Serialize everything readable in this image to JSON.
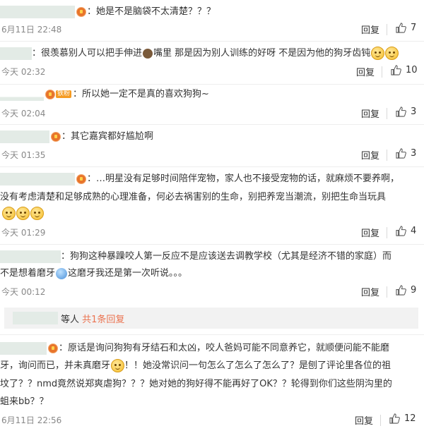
{
  "ui": {
    "reply_label": "回复",
    "accent": "#eb7350"
  },
  "comments": [
    {
      "text": "：她是不是脑袋不太清楚？？？",
      "time": "6月11日 22:48",
      "likes": "7"
    },
    {
      "text_a": "：很羡慕别人可以把手伸进",
      "text_b": "嘴里 那是因为别人训练的好呀 不是因为他的狗牙齿钝",
      "time": "今天 02:32",
      "likes": "10"
    },
    {
      "vip_tag": "铁粉",
      "text": "：所以她一定不是真的喜欢狗狗~",
      "time": "今天 02:04",
      "likes": "3"
    },
    {
      "text": "：其它嘉宾都好尴尬啊",
      "time": "今天 01:35",
      "likes": "3"
    },
    {
      "line1": "：…明星没有足够时间陪伴宠物，家人也不接受宠物的话，就麻烦不要养啊，",
      "line2": "没有考虑清楚和足够成熟的心理准备，何必去祸害别的生命，别把养宠当潮流，别把生命当玩具",
      "time": "今天 01:29",
      "likes": "4"
    },
    {
      "line1": "：狗狗这种暴躁咬人第一反应不是应该送去调教学校（尤其是经济不错的家庭）而",
      "line2a": "不是想着磨牙",
      "line2b": "这磨牙我还是第一次听说。。。",
      "time": "今天 00:12",
      "likes": "9"
    },
    {
      "line1": "：原话是询问狗狗有牙结石和太凶，咬人爸妈可能不同意养它，就顺便问能不能磨",
      "line2a": "牙，询问而已，并未真磨牙",
      "line2b": "！！她没常识问一句怎么了怎么了怎么了？是刨了评论里各位的祖",
      "line3": "坟了？？nmd竟然说郑爽虐狗？？？她对她的狗好得不能再好了OK？？轮得到你们这些阴沟里的",
      "line4": "蛆来bb？？",
      "time": "6月11日 22:56",
      "likes": "12"
    }
  ],
  "sub_reply": {
    "suffix": "等人",
    "count_text": "共1条回复"
  }
}
